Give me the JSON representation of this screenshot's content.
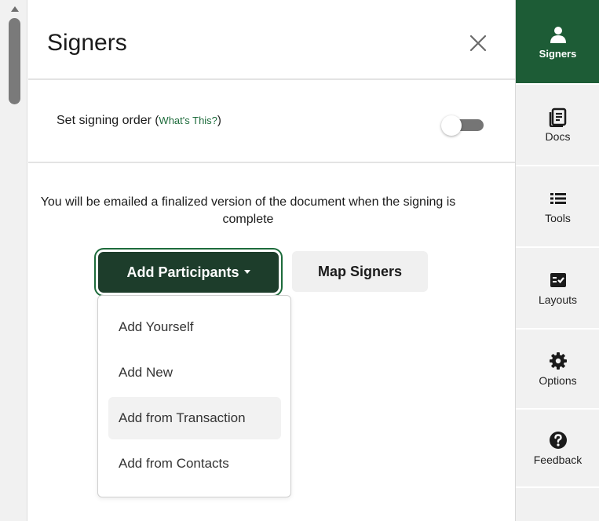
{
  "panel": {
    "title": "Signers",
    "signing_order_label": "Set signing order",
    "whats_this_link": "What's This?",
    "signing_order_enabled": false,
    "info_text": "You will be emailed a finalized version of the document when the signing is complete",
    "add_participants_label": "Add Participants",
    "map_signers_label": "Map Signers"
  },
  "dropdown": {
    "items": [
      {
        "label": "Add Yourself"
      },
      {
        "label": "Add New"
      },
      {
        "label": "Add from Transaction"
      },
      {
        "label": "Add from Contacts"
      }
    ],
    "hovered_index": 2
  },
  "sidebar": {
    "items": [
      {
        "label": "Signers",
        "icon": "person-icon",
        "active": true
      },
      {
        "label": "Docs",
        "icon": "document-icon",
        "active": false
      },
      {
        "label": "Tools",
        "icon": "list-icon",
        "active": false
      },
      {
        "label": "Layouts",
        "icon": "checklist-icon",
        "active": false
      },
      {
        "label": "Options",
        "icon": "gear-icon",
        "active": false
      },
      {
        "label": "Feedback",
        "icon": "question-icon",
        "active": false
      }
    ]
  },
  "colors": {
    "accent": "#1d5c36",
    "button_dark": "#1d3d2b",
    "link": "#1d6b3b"
  }
}
